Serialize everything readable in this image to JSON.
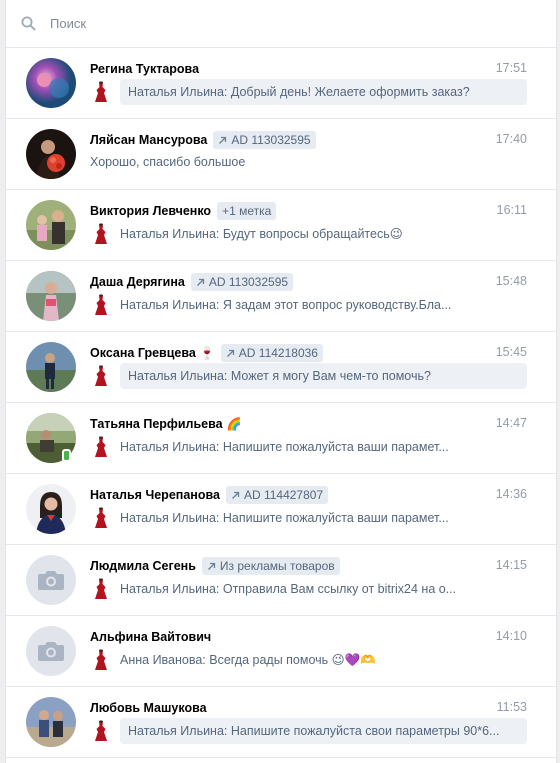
{
  "search": {
    "placeholder": "Поиск"
  },
  "dialogs": [
    {
      "name": "Регина Туктарова",
      "time": "17:51",
      "message": "Наталья Ильина: Добрый день! Желаете оформить заказ?",
      "unread": true,
      "avatar": "photo"
    },
    {
      "name": "Ляйсан Мансурова",
      "tag": "AD 113032595",
      "time": "17:40",
      "message": "Хорошо, спасибо большое",
      "avatar": "photo"
    },
    {
      "name": "Виктория Левченко",
      "tag": "+1 метка",
      "time": "16:11",
      "message": "Наталья Ильина: Будут вопросы обращайтесь😉",
      "avatar": "photo"
    },
    {
      "name": "Даша Дерягина",
      "tag": "AD 113032595",
      "time": "15:48",
      "message": "Наталья Ильина: Я задам этот вопрос руководству.Бла...",
      "avatar": "photo"
    },
    {
      "name": "Оксана Гревцева",
      "emoji": "🍷",
      "tag": "AD 114218036",
      "time": "15:45",
      "message": "Наталья Ильина: Может я могу Вам чем-то помочь?",
      "unread": true,
      "avatar": "photo"
    },
    {
      "name": "Татьяна Перфильева",
      "emoji": "🌈",
      "time": "14:47",
      "message": "Наталья Ильина: Напишите пожалуйста ваши парамет...",
      "avatar": "photo",
      "online_mobile": true
    },
    {
      "name": "Наталья Черепанова",
      "tag": "AD 114427807",
      "time": "14:36",
      "message": "Наталья Ильина: Напишите пожалуйста ваши парамет...",
      "avatar": "photo"
    },
    {
      "name": "Людмила Сегень",
      "tag": "Из рекламы товаров",
      "time": "14:15",
      "message": "Наталья Ильина: Отправила Вам ссылку от bitrix24 на о...",
      "avatar": "camera-placeholder"
    },
    {
      "name": "Альфина Вайтович",
      "time": "14:10",
      "message": "Анна Иванова: Всегда рады помочь 😉💜🫶",
      "avatar": "camera-placeholder"
    },
    {
      "name": "Любовь Машукова",
      "time": "11:53",
      "message": "Наталья Ильина: Напишите пожалуйста свои параметры 90*6...",
      "unread": true,
      "avatar": "photo"
    }
  ],
  "colors": {
    "accent_tag_bg": "#e5ebf1",
    "unread_bg": "#edf0f5",
    "online": "#4bb34b"
  },
  "icons": {
    "search": "search-icon",
    "tag": "arrow-up-right-icon",
    "sender": "dress-icon",
    "placeholder": "camera-icon"
  }
}
